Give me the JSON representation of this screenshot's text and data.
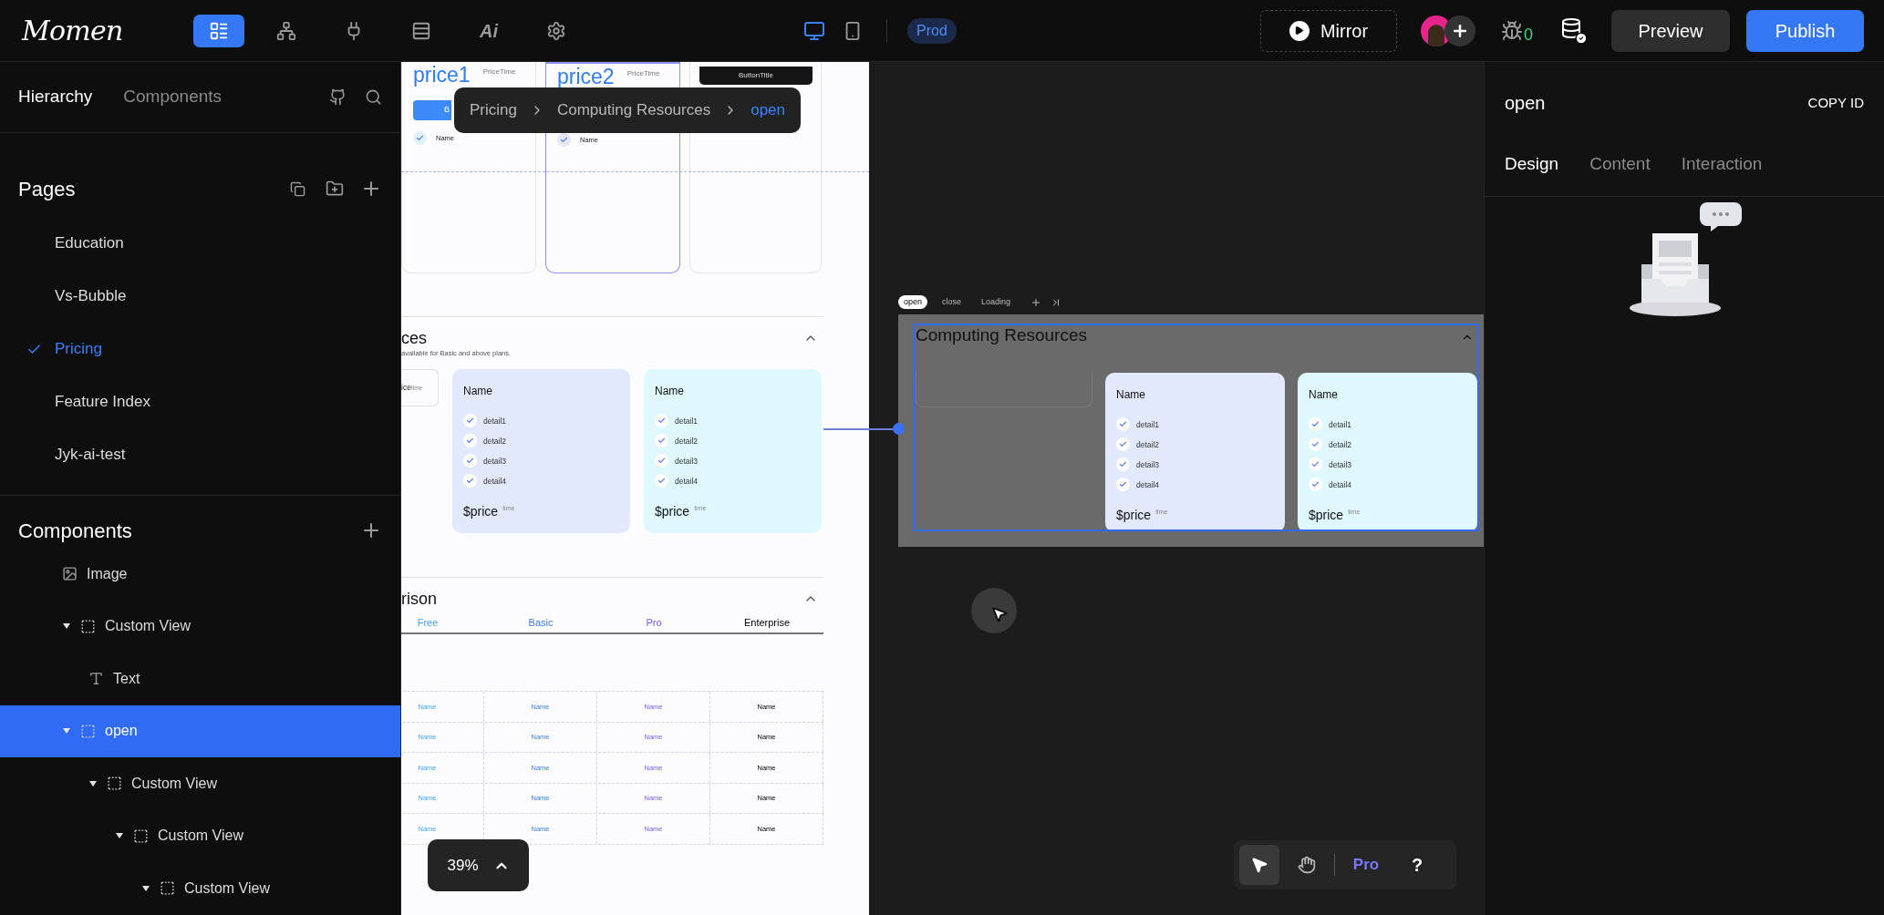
{
  "top_bar": {
    "logo": "Momen",
    "tools": [
      {
        "kind": "pages",
        "selected": true
      },
      {
        "kind": "flow",
        "selected": false
      },
      {
        "kind": "plugin",
        "selected": false
      },
      {
        "kind": "data",
        "selected": false
      },
      {
        "kind": "ai",
        "label": "Ai",
        "selected": false
      },
      {
        "kind": "settings",
        "selected": false
      }
    ],
    "devices": [
      {
        "kind": "desktop",
        "selected": true
      },
      {
        "kind": "mobile",
        "selected": false
      }
    ],
    "environment": "Prod",
    "mirror": "Mirror",
    "issue_count": "0",
    "preview": "Preview",
    "publish": "Publish"
  },
  "left_panel": {
    "tabs": [
      {
        "label": "Hierarchy",
        "selected": true
      },
      {
        "label": "Components",
        "selected": false
      }
    ],
    "pages": {
      "title": "Pages",
      "items": [
        {
          "label": "Education",
          "selected": false
        },
        {
          "label": "Vs-Bubble",
          "selected": false
        },
        {
          "label": "Pricing",
          "selected": true
        },
        {
          "label": "Feature Index",
          "selected": false
        },
        {
          "label": "Jyk-ai-test",
          "selected": false
        }
      ]
    },
    "components": {
      "title": "Components",
      "tree": [
        {
          "label": "Image",
          "kind": "image",
          "selected": false
        },
        {
          "label": "Custom View",
          "kind": "view",
          "expanded": true,
          "selected": false,
          "children": [
            {
              "label": "Text",
              "kind": "text",
              "selected": false
            }
          ]
        },
        {
          "label": "open",
          "kind": "view",
          "expanded": true,
          "selected": true,
          "children": [
            {
              "label": "Custom View",
              "kind": "view",
              "expanded": true,
              "selected": false,
              "children": [
                {
                  "label": "Custom View",
                  "kind": "view",
                  "expanded": true,
                  "selected": false,
                  "children": [
                    {
                      "label": "Custom View",
                      "kind": "view",
                      "expanded": true,
                      "selected": false
                    }
                  ]
                }
              ]
            }
          ]
        }
      ]
    }
  },
  "canvas": {
    "breadcrumb": [
      "Pricing",
      "Computing Resources",
      "open"
    ],
    "page_preview": {
      "plans": [
        {
          "price": "price1",
          "time": "PriceTime",
          "button": "B",
          "feature": "Name",
          "selected": false
        },
        {
          "price": "price2",
          "time": "PriceTime",
          "feature": "Name",
          "selected": true
        }
      ],
      "third_plan_button": "ButtonTitle",
      "resources": {
        "title": "ces",
        "subtitle": "available for Basic and above plans.",
        "mini_card": {
          "price": "ice",
          "time": "time"
        },
        "cards": [
          {
            "name": "Name",
            "details": [
              "detail1",
              "detail2",
              "detail3",
              "detail4"
            ],
            "price": "$price",
            "time": "time",
            "color": "#e3e9fd"
          },
          {
            "name": "Name",
            "details": [
              "detail1",
              "detail2",
              "detail3",
              "detail4"
            ],
            "price": "$price",
            "time": "time",
            "color": "#dff8fd"
          }
        ]
      },
      "comparison": {
        "title": "rison",
        "columns": [
          {
            "label": "Free",
            "color": "#3fa3f7"
          },
          {
            "label": "Basic",
            "color": "#3b7cf0"
          },
          {
            "label": "Pro",
            "color": "#7a5af5"
          },
          {
            "label": "Enterprise",
            "color": "#000000"
          }
        ],
        "rows": [
          [
            "Name",
            "Name",
            "Name",
            "Name"
          ],
          [
            "Name",
            "Name",
            "Name",
            "Name"
          ],
          [
            "Name",
            "Name",
            "Name",
            "Name"
          ],
          [
            "Name",
            "Name",
            "Name",
            "Name"
          ],
          [
            "Name",
            "Name",
            "Name",
            "Name"
          ]
        ]
      }
    },
    "zoom": "39%",
    "state_tabs": [
      {
        "label": "open",
        "selected": true
      },
      {
        "label": "close",
        "selected": false
      },
      {
        "label": "Loading",
        "selected": false
      }
    ],
    "artboard": {
      "title": "Computing Resources",
      "cards": [
        {
          "name": "Name",
          "details": [
            "detail1",
            "detail2",
            "detail3",
            "detail4"
          ],
          "price": "$price",
          "time": "time",
          "color": "#e3e9fd"
        },
        {
          "name": "Name",
          "details": [
            "detail1",
            "detail2",
            "detail3",
            "detail4"
          ],
          "price": "$price",
          "time": "time",
          "color": "#dff8fd"
        }
      ]
    },
    "tools": [
      {
        "kind": "select",
        "selected": true
      },
      {
        "kind": "hand",
        "selected": false
      }
    ],
    "pro": "Pro",
    "help": "?"
  },
  "right_panel": {
    "title": "open",
    "copy_id": "COPY ID",
    "tabs": [
      {
        "label": "Design",
        "selected": true
      },
      {
        "label": "Content",
        "selected": false
      },
      {
        "label": "Interaction",
        "selected": false
      }
    ]
  }
}
